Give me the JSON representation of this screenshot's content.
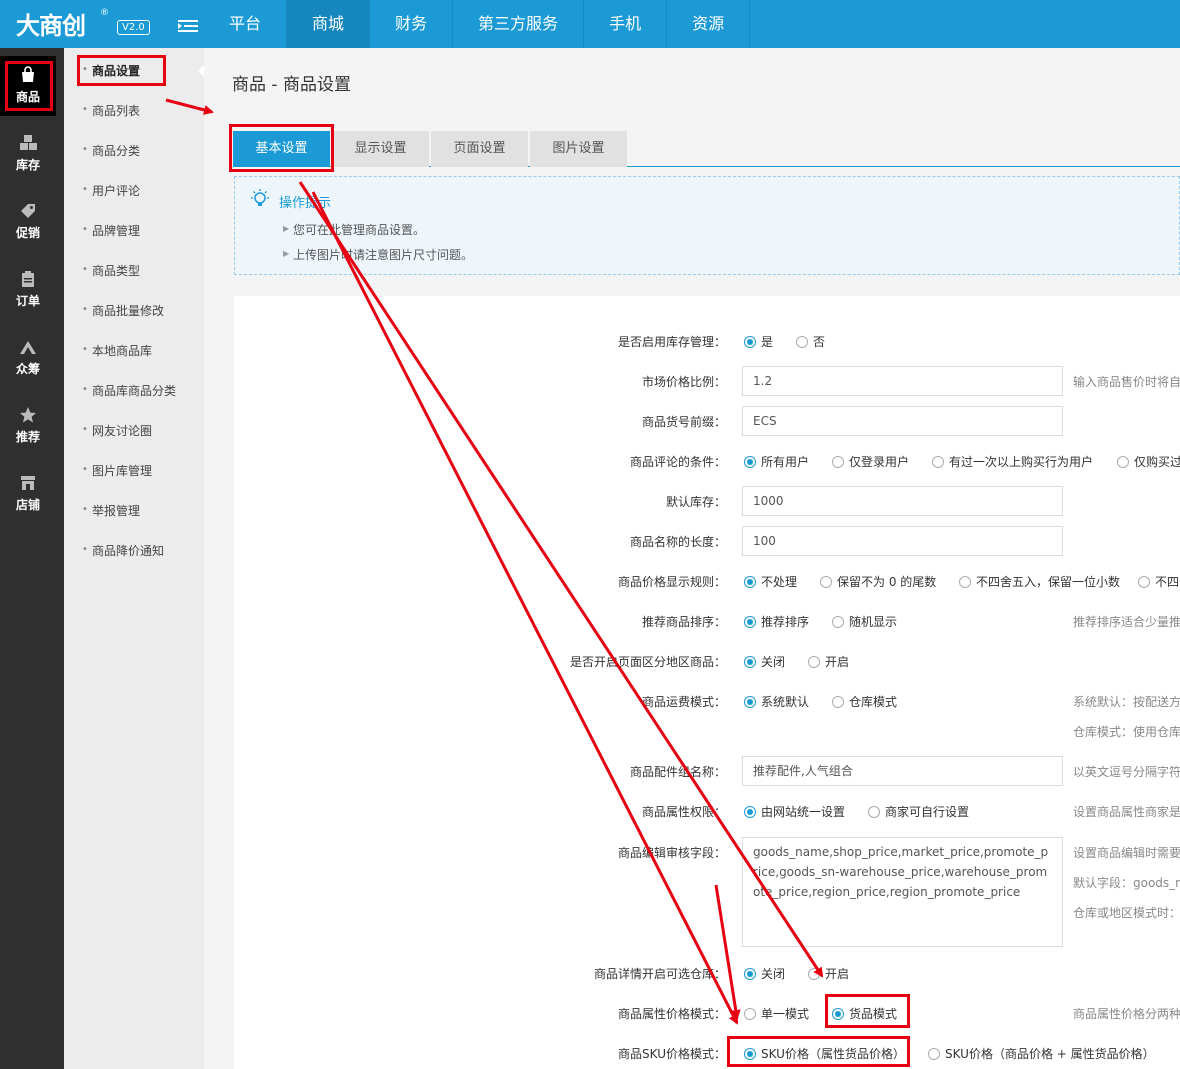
{
  "logo": {
    "text": "大商创",
    "reg": "®",
    "version": "V2.0"
  },
  "topnav": [
    "平台",
    "商城",
    "财务",
    "第三方服务",
    "手机",
    "资源"
  ],
  "leftbar": [
    {
      "label": "商品",
      "icon": "bag-icon"
    },
    {
      "label": "库存",
      "icon": "boxes-icon"
    },
    {
      "label": "促销",
      "icon": "tag-icon"
    },
    {
      "label": "订单",
      "icon": "clipboard-icon"
    },
    {
      "label": "众筹",
      "icon": "crowdfund-icon"
    },
    {
      "label": "推荐",
      "icon": "star-icon"
    },
    {
      "label": "店铺",
      "icon": "shop-icon"
    }
  ],
  "subnav": [
    "商品设置",
    "商品列表",
    "商品分类",
    "用户评论",
    "品牌管理",
    "商品类型",
    "商品批量修改",
    "本地商品库",
    "商品库商品分类",
    "网友讨论圈",
    "图片库管理",
    "举报管理",
    "商品降价通知"
  ],
  "page": {
    "title": "商品 - 商品设置"
  },
  "tabs": [
    "基本设置",
    "显示设置",
    "页面设置",
    "图片设置"
  ],
  "tips": {
    "title": "操作提示",
    "lines": [
      "您可在此管理商品设置。",
      "上传图片时请注意图片尺寸问题。"
    ]
  },
  "form": {
    "stock": {
      "label": "是否启用库存管理：",
      "options": [
        "是",
        "否"
      ]
    },
    "market_ratio": {
      "label": "市场价格比例：",
      "value": "1.2",
      "hint": "输入商品售价时将自"
    },
    "sn_prefix": {
      "label": "商品货号前缀：",
      "value": "ECS"
    },
    "comment": {
      "label": "商品评论的条件：",
      "options": [
        "所有用户",
        "仅登录用户",
        "有过一次以上购买行为用户",
        "仅购买过"
      ]
    },
    "default_stock": {
      "label": "默认库存：",
      "value": "1000"
    },
    "name_len": {
      "label": "商品名称的长度：",
      "value": "100"
    },
    "price_rule": {
      "label": "商品价格显示规则：",
      "options": [
        "不处理",
        "保留不为 0 的尾数",
        "不四舍五入，保留一位小数",
        "不四"
      ]
    },
    "recommend_sort": {
      "label": "推荐商品排序：",
      "options": [
        "推荐排序",
        "随机显示"
      ],
      "hint": "推荐排序适合少量推"
    },
    "region": {
      "label": "是否开启页面区分地区商品：",
      "options": [
        "关闭",
        "开启"
      ]
    },
    "freight": {
      "label": "商品运费模式：",
      "options": [
        "系统默认",
        "仓库模式"
      ],
      "hint1": "系统默认：按配送方",
      "hint2": "仓库模式：使用仓库"
    },
    "parts": {
      "label": "商品配件组名称：",
      "value": "推荐配件,人气组合",
      "hint": "以英文逗号分隔字符"
    },
    "attr_perm": {
      "label": "商品属性权限：",
      "options": [
        "由网站统一设置",
        "商家可自行设置"
      ],
      "hint": "设置商品属性商家是"
    },
    "edit_fields": {
      "label": "商品编辑审核字段：",
      "value": "goods_name,shop_price,market_price,promote_price,goods_sn-warehouse_price,warehouse_promote_price,region_price,region_promote_price",
      "hint1": "设置商品编辑时需要",
      "hint2": "默认字段：goods_n",
      "hint3": "仓库或地区模式时："
    },
    "warehouse": {
      "label": "商品详情开启可选仓库：",
      "options": [
        "关闭",
        "开启"
      ]
    },
    "attr_price": {
      "label": "商品属性价格模式：",
      "options": [
        "单一模式",
        "货品模式"
      ],
      "hint": "商品属性价格分两种"
    },
    "sku_price": {
      "label": "商品SKU价格模式：",
      "options": [
        "SKU价格（属性货品价格）",
        "SKU价格（商品价格 + 属性货品价格）"
      ]
    }
  }
}
